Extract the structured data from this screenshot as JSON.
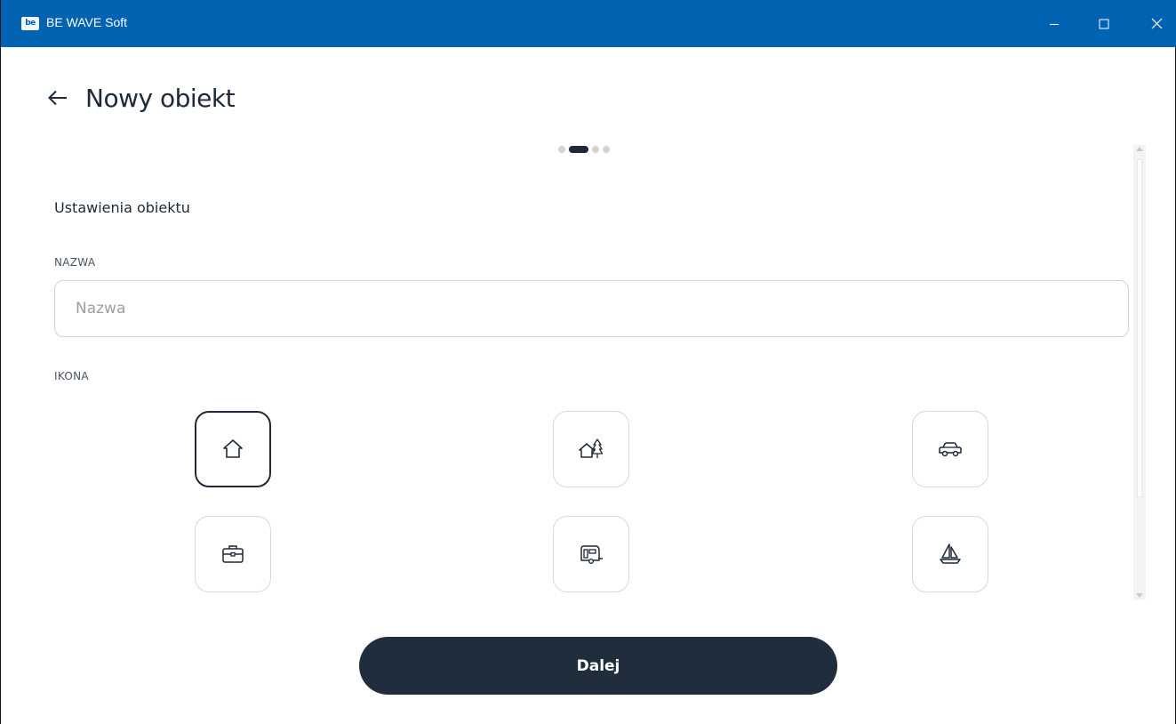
{
  "window": {
    "app_logo": "be",
    "app_title": "BE WAVE Soft",
    "controls": {
      "minimize": "minimize-icon",
      "maximize": "maximize-icon",
      "close": "close-icon"
    }
  },
  "header": {
    "back_icon": "arrow-left-icon",
    "title": "Nowy obiekt"
  },
  "stepper": {
    "total": 4,
    "active_index": 1
  },
  "form": {
    "section_title": "Ustawienia obiektu",
    "name_label": "NAZWA",
    "name_placeholder": "Nazwa",
    "name_value": "",
    "icon_label": "IKONA",
    "icons": [
      {
        "name": "house-icon",
        "selected": true
      },
      {
        "name": "house-trees-icon",
        "selected": false
      },
      {
        "name": "car-icon",
        "selected": false
      },
      {
        "name": "briefcase-icon",
        "selected": false
      },
      {
        "name": "caravan-icon",
        "selected": false
      },
      {
        "name": "sailboat-icon",
        "selected": false
      }
    ]
  },
  "actions": {
    "next_label": "Dalej"
  },
  "colors": {
    "titlebar": "#0063b1",
    "primary_dark": "#1f2d3d",
    "accent_dot": "#1f2937",
    "border": "#d6d9dd"
  }
}
